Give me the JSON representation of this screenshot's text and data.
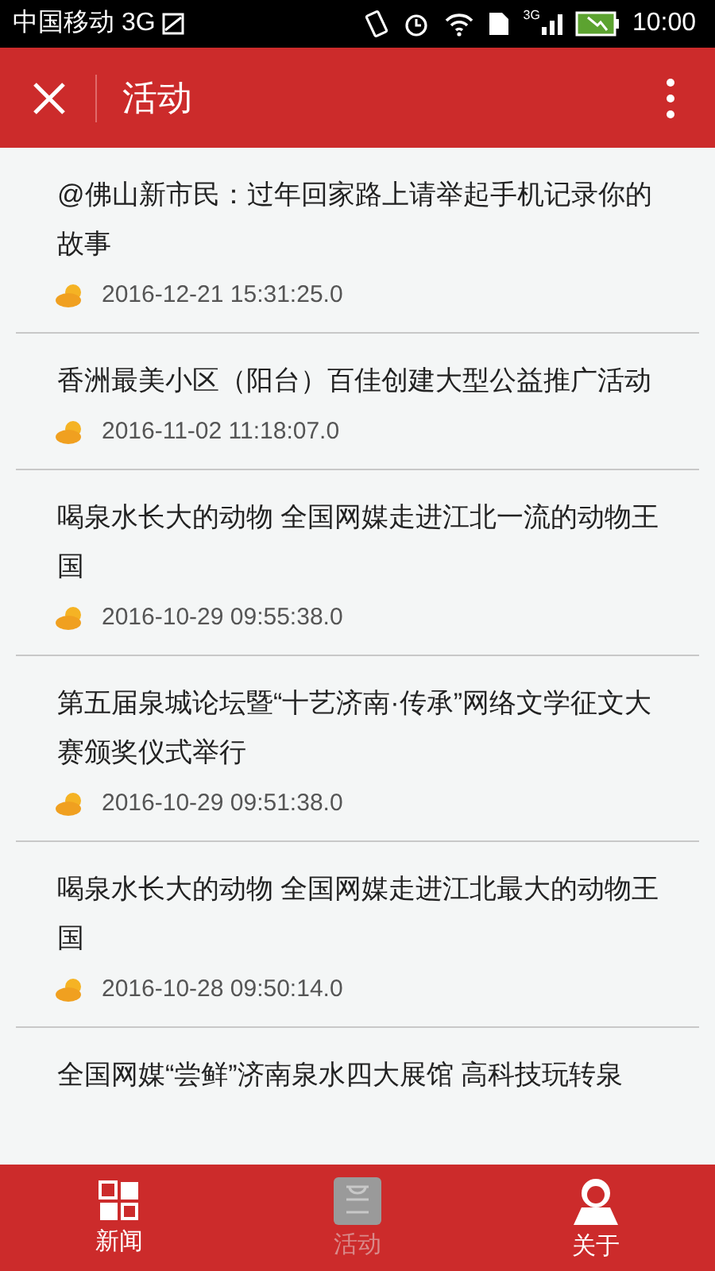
{
  "status_bar": {
    "carrier": "中国移动 3G",
    "network": "3G",
    "time": "10:00"
  },
  "header": {
    "title": "活动"
  },
  "items": [
    {
      "title": "@佛山新市民：过年回家路上请举起手机记录你的故事",
      "date": "2016-12-21 15:31:25.0"
    },
    {
      "title": "香洲最美小区（阳台）百佳创建大型公益推广活动",
      "date": "2016-11-02 11:18:07.0"
    },
    {
      "title": "喝泉水长大的动物 全国网媒走进江北一流的动物王国",
      "date": "2016-10-29 09:55:38.0"
    },
    {
      "title": "第五届泉城论坛暨“十艺济南·传承”网络文学征文大赛颁奖仪式举行",
      "date": "2016-10-29 09:51:38.0"
    },
    {
      "title": "喝泉水长大的动物 全国网媒走进江北最大的动物王国",
      "date": "2016-10-28 09:50:14.0"
    },
    {
      "title": "全国网媒“尝鲜”济南泉水四大展馆 高科技玩转泉"
    }
  ],
  "tabs": [
    {
      "label": "新闻",
      "selected": false,
      "kind": "grid"
    },
    {
      "label": "活动",
      "selected": true,
      "kind": "list"
    },
    {
      "label": "关于",
      "selected": false,
      "kind": "person"
    }
  ]
}
